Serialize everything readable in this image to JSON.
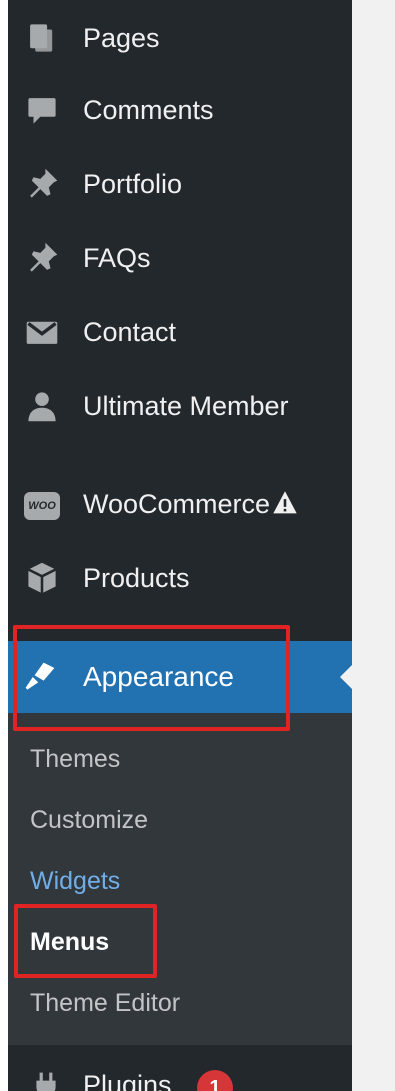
{
  "menu": {
    "pages": "Pages",
    "comments": "Comments",
    "portfolio": "Portfolio",
    "faqs": "FAQs",
    "contact": "Contact",
    "ultimate_member": "Ultimate Member",
    "woocommerce": "WooCommerce",
    "woo_icon_text": "WOO",
    "products": "Products",
    "appearance": "Appearance",
    "plugins": "Plugins",
    "plugins_badge": "1"
  },
  "submenu": {
    "themes": "Themes",
    "customize": "Customize",
    "widgets": "Widgets",
    "menus": "Menus",
    "theme_editor": "Theme Editor"
  },
  "colors": {
    "sidebar_bg": "#23282d",
    "active_bg": "#2271b1",
    "submenu_bg": "#32373c",
    "link_hover": "#72aee6",
    "highlight_red": "#e02424",
    "badge_bg": "#d63638"
  }
}
